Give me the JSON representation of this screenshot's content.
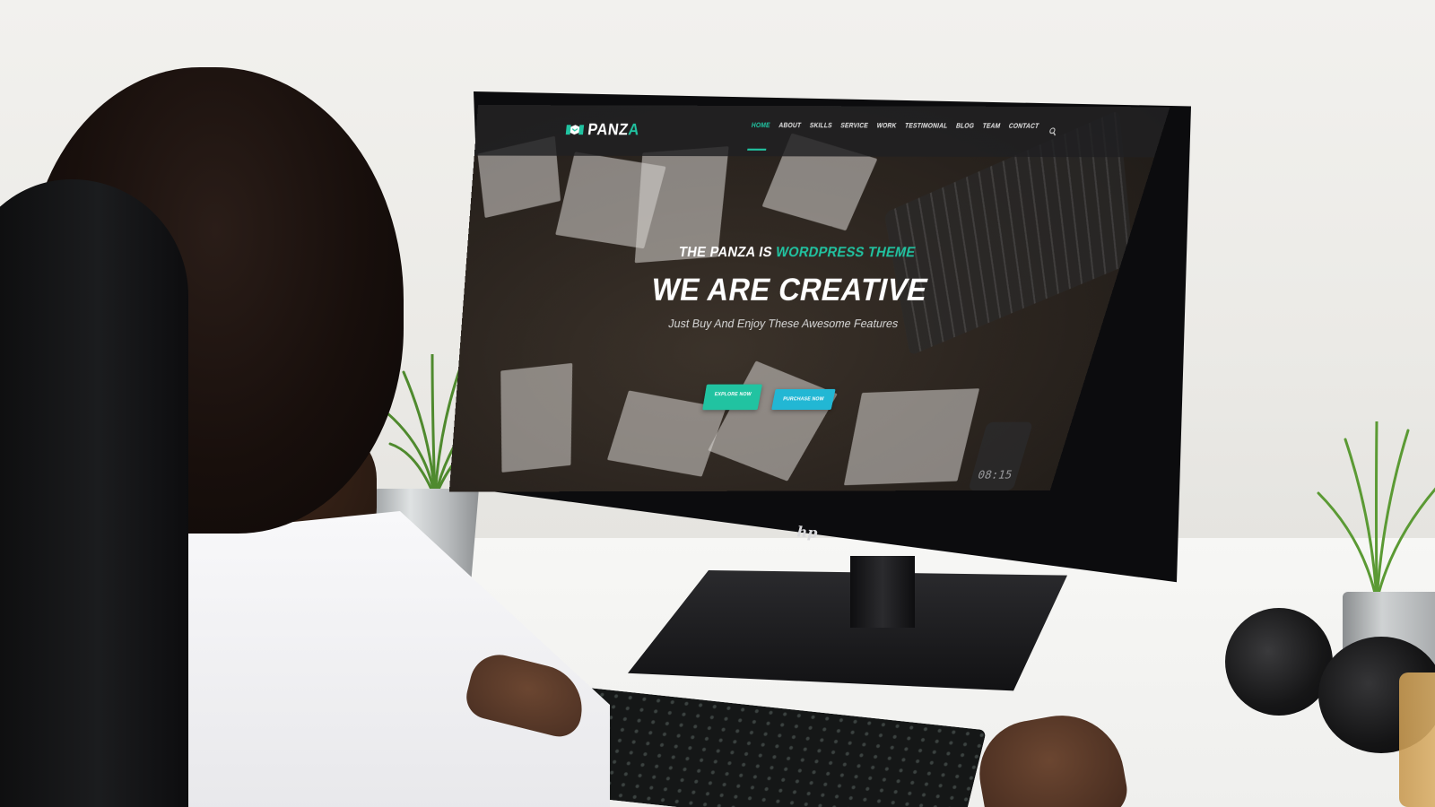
{
  "site": {
    "logo": {
      "text": "PANZ",
      "accent": "A",
      "icon": "handshake-icon"
    },
    "nav": [
      {
        "label": "HOME",
        "active": true
      },
      {
        "label": "ABOUT",
        "active": false
      },
      {
        "label": "SKILLS",
        "active": false
      },
      {
        "label": "SERVICE",
        "active": false
      },
      {
        "label": "WORK",
        "active": false
      },
      {
        "label": "TESTIMONIAL",
        "active": false
      },
      {
        "label": "BLOG",
        "active": false
      },
      {
        "label": "TEAM",
        "active": false
      },
      {
        "label": "CONTACT",
        "active": false
      }
    ],
    "search_icon": "search-icon"
  },
  "hero": {
    "kicker": "THE PANZA IS ",
    "kicker_accent": "WORDPRESS THEME",
    "title": "WE ARE CREATIVE",
    "subtitle": "Just Buy And Enjoy These Awesome Features",
    "buttons": {
      "explore": "EXPLORE NOW",
      "purchase": "PURCHASE NOW"
    }
  },
  "scene": {
    "phone_clock": "08:15",
    "monitor_brand_icon": "hp-logo-icon"
  },
  "colors": {
    "accent": "#21c3a1",
    "secondary_button": "#22b7d4",
    "header_bg": "#202022"
  }
}
